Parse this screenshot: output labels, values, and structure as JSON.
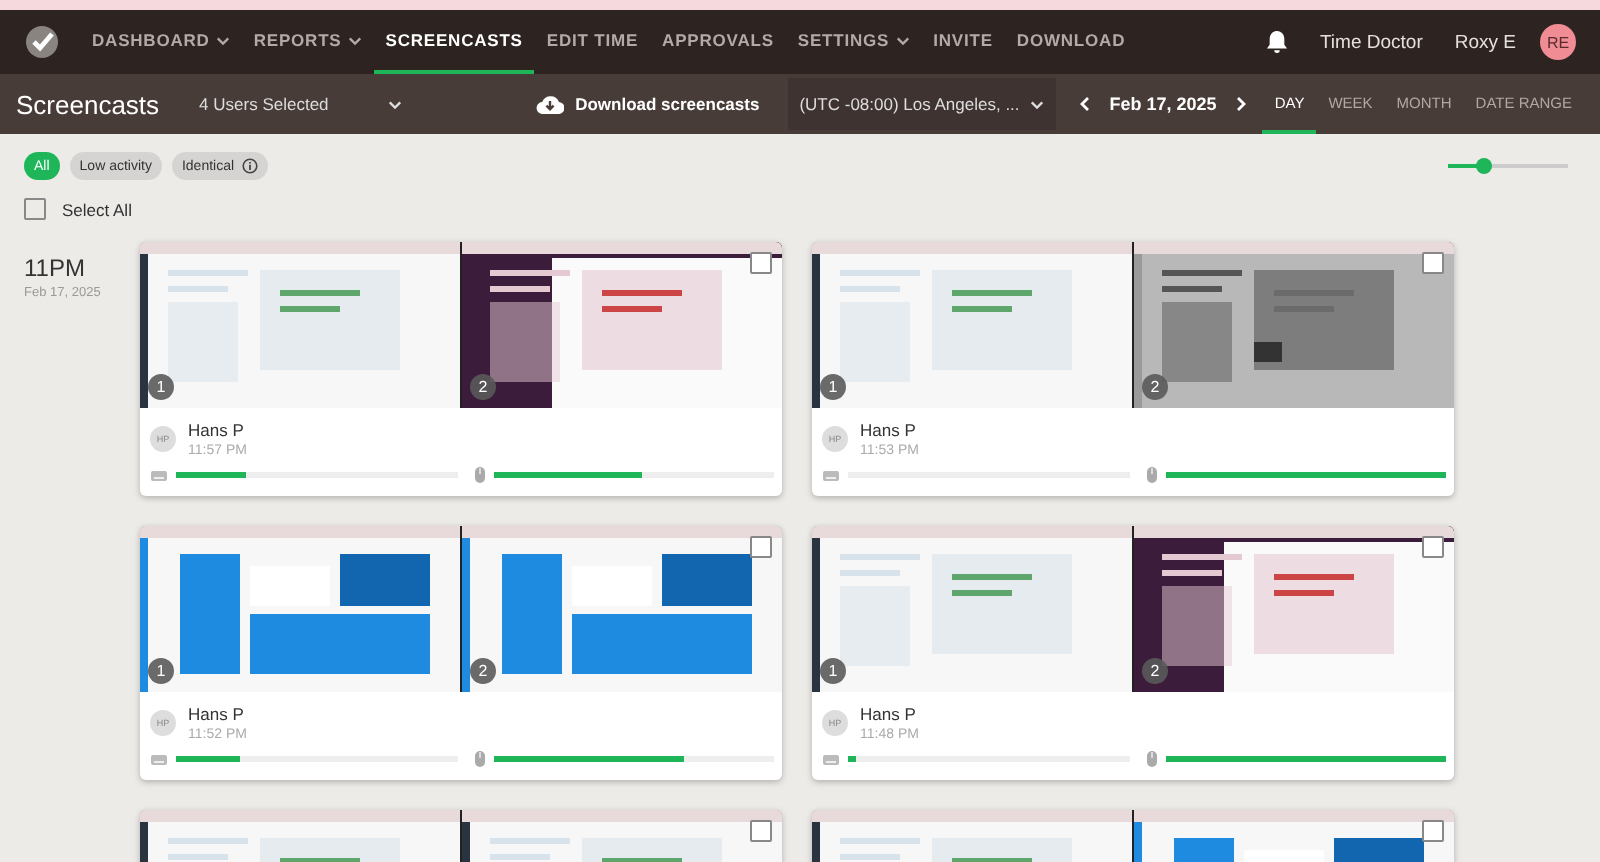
{
  "nav": {
    "items": [
      {
        "label": "DASHBOARD",
        "dropdown": true,
        "selected": false
      },
      {
        "label": "REPORTS",
        "dropdown": true,
        "selected": false
      },
      {
        "label": "SCREENCASTS",
        "dropdown": false,
        "selected": true
      },
      {
        "label": "EDIT TIME",
        "dropdown": false,
        "selected": false
      },
      {
        "label": "APPROVALS",
        "dropdown": false,
        "selected": false
      },
      {
        "label": "SETTINGS",
        "dropdown": true,
        "selected": false
      },
      {
        "label": "INVITE",
        "dropdown": false,
        "selected": false
      },
      {
        "label": "DOWNLOAD",
        "dropdown": false,
        "selected": false
      }
    ],
    "company": "Time Doctor",
    "user": "Roxy E",
    "avatar": "RE"
  },
  "toolbar": {
    "title": "Screencasts",
    "users": "4 Users Selected",
    "download": "Download screencasts",
    "timezone": "(UTC -08:00) Los Angeles, ...",
    "date": "Feb 17, 2025",
    "ranges": [
      {
        "label": "DAY",
        "selected": true
      },
      {
        "label": "WEEK",
        "selected": false
      },
      {
        "label": "MONTH",
        "selected": false
      },
      {
        "label": "DATE RANGE",
        "selected": false
      }
    ]
  },
  "filters": [
    {
      "label": "All",
      "selected": true,
      "info": false
    },
    {
      "label": "Low activity",
      "selected": false,
      "info": false
    },
    {
      "label": "Identical",
      "selected": false,
      "info": true
    }
  ],
  "zoom": {
    "level": 0.3
  },
  "select_all": {
    "label": "Select All",
    "checked": false
  },
  "group": {
    "hour": "11PM",
    "date": "Feb 17, 2025"
  },
  "cards": [
    {
      "thumbs": [
        {
          "kind": "picture",
          "number": "1"
        },
        {
          "kind": "picture",
          "number": "2"
        }
      ],
      "checked": false,
      "initials": "HP",
      "name": "Hans P",
      "time": "11:57 PM",
      "keyboard": {
        "level": 0.25
      },
      "mouse": {
        "level": 0.53
      }
    },
    {
      "thumbs": [
        {
          "kind": "picture",
          "number": "1"
        },
        {
          "kind": "picture",
          "number": "2"
        }
      ],
      "checked": false,
      "initials": "HP",
      "name": "Hans P",
      "time": "11:53 PM",
      "keyboard": {
        "level": 0
      },
      "mouse": {
        "level": 1
      }
    },
    {
      "thumbs": [
        {
          "kind": "picture",
          "number": "1"
        },
        {
          "kind": "picture",
          "number": "2"
        }
      ],
      "checked": false,
      "initials": "HP",
      "name": "Hans P",
      "time": "11:52 PM",
      "keyboard": {
        "level": 0.23
      },
      "mouse": {
        "level": 0.68
      }
    },
    {
      "thumbs": [
        {
          "kind": "picture",
          "number": "1"
        },
        {
          "kind": "picture",
          "number": "2"
        }
      ],
      "checked": false,
      "initials": "HP",
      "name": "Hans P",
      "time": "11:48 PM",
      "keyboard": {
        "level": 0.03
      },
      "mouse": {
        "level": 1
      }
    },
    {
      "checked": false
    },
    {
      "checked": false
    }
  ]
}
